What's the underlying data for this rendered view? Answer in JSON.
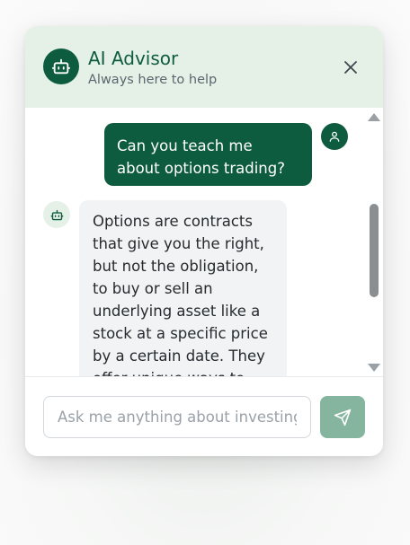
{
  "header": {
    "title": "AI Advisor",
    "subtitle": "Always here to help",
    "avatar_icon": "robot-icon",
    "close_icon": "close-icon"
  },
  "messages": [
    {
      "role": "user",
      "text": "Can you teach me about options trading?",
      "avatar_icon": "user-icon"
    },
    {
      "role": "assistant",
      "text": "Options are contracts that give you the right, but not the obligation, to buy or sell an underlying asset like a stock at a specific price by a certain date. They offer unique ways to",
      "avatar_icon": "robot-icon"
    }
  ],
  "composer": {
    "placeholder": "Ask me anything about investing...",
    "value": "",
    "send_icon": "send-icon"
  },
  "colors": {
    "brand": "#0e5c40",
    "header_bg": "#e5f1e7",
    "assistant_bubble": "#f2f3f5",
    "send_button": "#86b59f"
  }
}
